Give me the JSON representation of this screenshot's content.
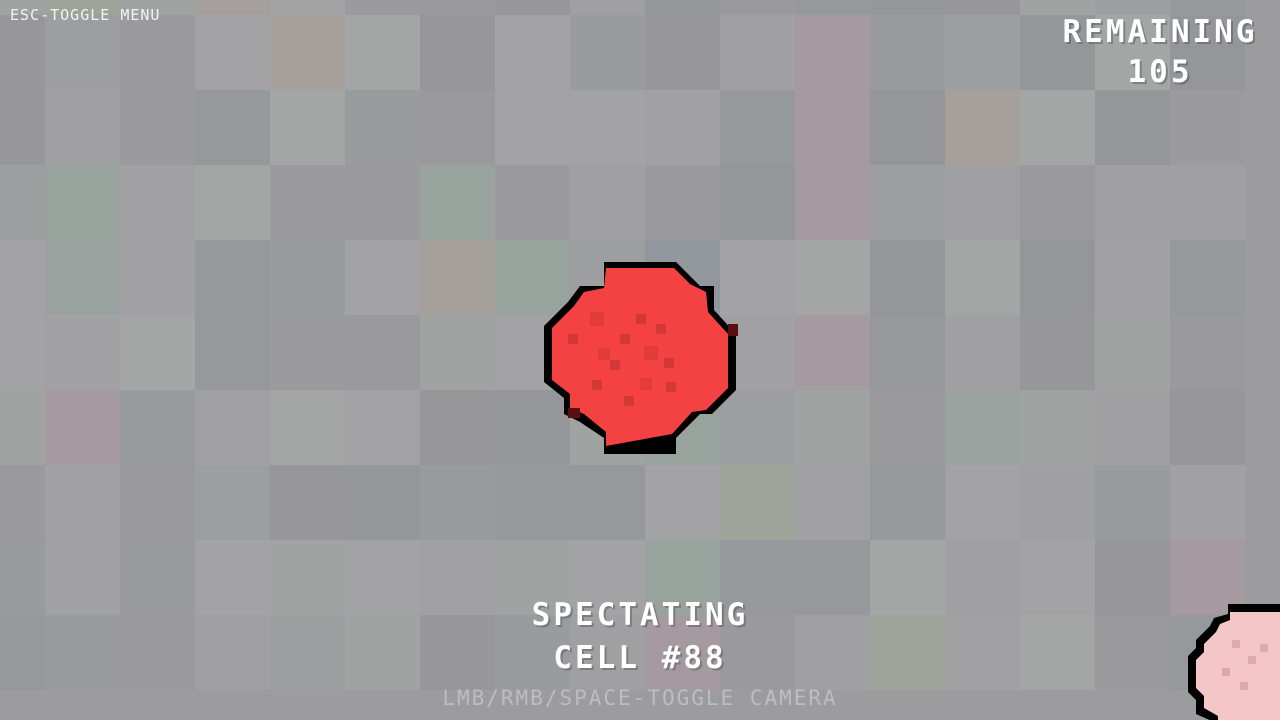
{
  "hud": {
    "menu_hint": "ESC-TOGGLE MENU",
    "remaining_label": "REMAINING",
    "remaining_count": "105",
    "spectating_label": "SPECTATING",
    "spectating_cell": "CELL #88",
    "camera_hint": "LMB/RMB/SPACE-TOGGLE CAMERA"
  },
  "colors": {
    "spectated_cell_fill": "#f44242",
    "spectated_cell_outline": "#000000",
    "other_cell_fill": "#f5c6c6",
    "text": "#ffffff",
    "hint_text": "#bdbdc0"
  },
  "entities": {
    "spectated_cell": {
      "name": "cell-88",
      "icon": "red-pixel-cell"
    },
    "other_cell": {
      "name": "pink-cell",
      "icon": "pink-pixel-cell"
    }
  }
}
